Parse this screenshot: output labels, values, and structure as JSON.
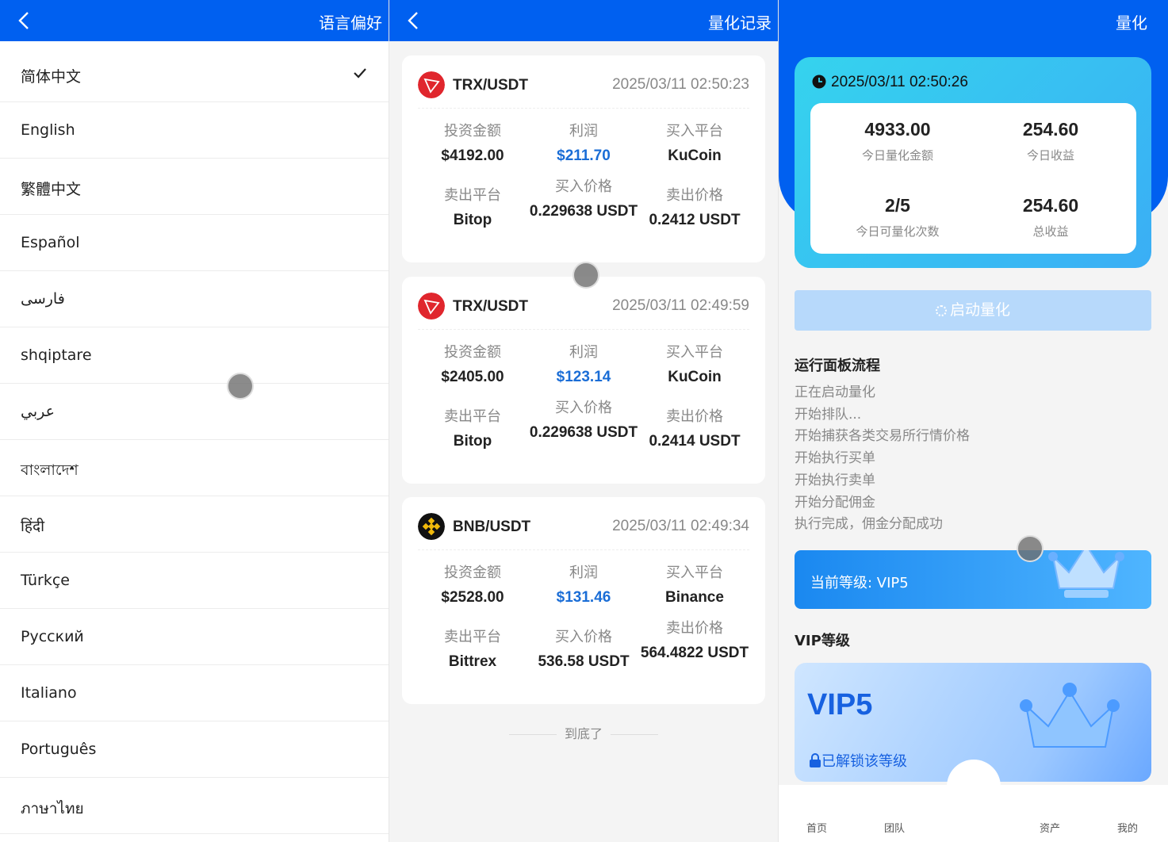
{
  "language_screen": {
    "title": "语言偏好",
    "languages": [
      {
        "label": "简体中文",
        "selected": true
      },
      {
        "label": "English",
        "selected": false
      },
      {
        "label": "繁體中文",
        "selected": false
      },
      {
        "label": "Español",
        "selected": false
      },
      {
        "label": "فارسی",
        "selected": false
      },
      {
        "label": "shqiptare",
        "selected": false
      },
      {
        "label": "عربي",
        "selected": false
      },
      {
        "label": "বাংলাদেশ",
        "selected": false
      },
      {
        "label": "हिंदी",
        "selected": false
      },
      {
        "label": "Türkçe",
        "selected": false
      },
      {
        "label": "Русский",
        "selected": false
      },
      {
        "label": "Italiano",
        "selected": false
      },
      {
        "label": "Português",
        "selected": false
      },
      {
        "label": "ภาษาไทย",
        "selected": false
      }
    ]
  },
  "records_screen": {
    "title": "量化记录",
    "labels": {
      "invest": "投资金额",
      "profit": "利润",
      "buy_platform": "买入平台",
      "sell_platform": "卖出平台",
      "buy_price": "买入价格",
      "sell_price": "卖出价格"
    },
    "records": [
      {
        "pair": "TRX/USDT",
        "coin_icon": "tron-icon",
        "time": "2025/03/11 02:50:23",
        "invest": "$4192.00",
        "profit": "$211.70",
        "buy_platform": "KuCoin",
        "sell_platform": "Bitop",
        "buy_price": "0.229638 USDT",
        "sell_price": "0.2412 USDT"
      },
      {
        "pair": "TRX/USDT",
        "coin_icon": "tron-icon",
        "time": "2025/03/11 02:49:59",
        "invest": "$2405.00",
        "profit": "$123.14",
        "buy_platform": "KuCoin",
        "sell_platform": "Bitop",
        "buy_price": "0.229638 USDT",
        "sell_price": "0.2414 USDT"
      },
      {
        "pair": "BNB/USDT",
        "coin_icon": "bnb-icon",
        "time": "2025/03/11 02:49:34",
        "invest": "$2528.00",
        "profit": "$131.46",
        "buy_platform": "Binance",
        "sell_platform": "Bittrex",
        "buy_price": "536.58 USDT",
        "sell_price": "564.4822 USDT"
      }
    ],
    "end_text": "到底了"
  },
  "quant_screen": {
    "title": "量化",
    "time": "2025/03/11 02:50:26",
    "stats": {
      "today_amount": "4933.00",
      "today_amount_label": "今日量化金额",
      "today_income": "254.60",
      "today_income_label": "今日收益",
      "today_count": "2/5",
      "today_count_label": "今日可量化次数",
      "total_income": "254.60",
      "total_income_label": "总收益"
    },
    "start_button": "启动量化",
    "process_title": "运行面板流程",
    "steps": [
      "正在启动量化",
      "开始排队...",
      "开始捕获各类交易所行情价格",
      "开始执行买单",
      "开始执行卖单",
      "开始分配佣金",
      "执行完成，佣金分配成功"
    ],
    "current_level": "当前等级: VIP5",
    "vip_title": "VIP等级",
    "vip_card": {
      "level": "VIP5",
      "status": "已解锁该等级"
    },
    "tabs": [
      "首页",
      "团队",
      "资产",
      "我的"
    ]
  },
  "colors": {
    "header": "#0060f0",
    "profit": "#1a6dd6",
    "panel": "#35d3ee"
  }
}
